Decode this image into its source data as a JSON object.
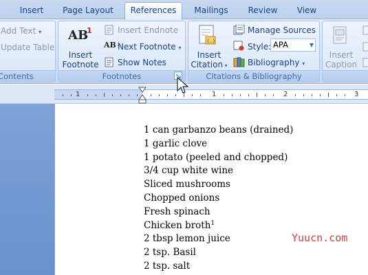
{
  "tabs": [
    "Insert",
    "Page Layout",
    "References",
    "Mailings",
    "Review",
    "View"
  ],
  "active_tab": "References",
  "ribbon": {
    "contents_group": {
      "add_text": "Add Text",
      "update_table": "Update Table",
      "label": "Contents"
    },
    "footnotes_group": {
      "insert_footnote_line1": "Insert",
      "insert_footnote_line2": "Footnote",
      "insert_endnote": "Insert Endnote",
      "next_footnote": "Next Footnote",
      "show_notes": "Show Notes",
      "label": "Footnotes",
      "icon_text": "AB",
      "icon_sup": "1"
    },
    "citations_group": {
      "insert_citation_line1": "Insert",
      "insert_citation_line2": "Citation",
      "manage_sources": "Manage Sources",
      "style_label": "Style:",
      "style_value": "APA",
      "bibliography": "Bibliography",
      "label": "Citations & Bibliography"
    },
    "captions_group": {
      "insert_caption_line1": "Insert",
      "insert_caption_line2": "Caption"
    }
  },
  "ruler": {
    "numbers": [
      "1",
      "1",
      "2",
      "3"
    ]
  },
  "document": {
    "lines": [
      "1 can garbanzo beans (drained)",
      "1 garlic clove",
      "1 potato (peeled and chopped)",
      "3/4 cup white wine",
      "Sliced mushrooms",
      "Chopped onions",
      "Fresh spinach",
      "Chicken broth",
      "2 tbsp lemon juice",
      "2 tsp. Basil",
      "2 tsp. salt"
    ],
    "footnote_ref": "1"
  },
  "watermark": "Yuucn.com"
}
